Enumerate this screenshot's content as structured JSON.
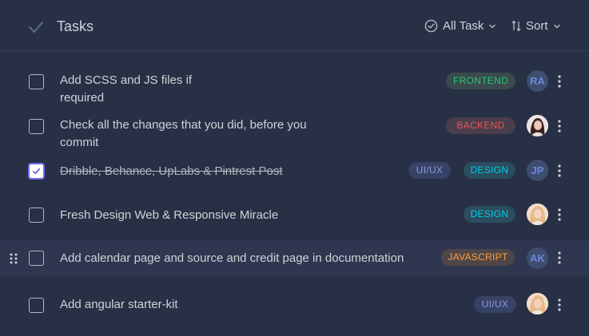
{
  "header": {
    "title": "Tasks",
    "filter_label": "All Task",
    "sort_label": "Sort"
  },
  "tasks": [
    {
      "title_lines": [
        "Add SCSS and JS files if",
        "required"
      ],
      "completed": false,
      "tags": [
        "FRONTEND"
      ],
      "assignee": {
        "initials": "RA",
        "avatar": "initials"
      }
    },
    {
      "title_lines": [
        "Check all the changes that you did, before you",
        "commit"
      ],
      "completed": false,
      "tags": [
        "BACKEND"
      ],
      "assignee": {
        "avatar": "photo"
      }
    },
    {
      "title_lines": [
        "Dribble, Behance, UpLabs & Pintrest Post"
      ],
      "completed": true,
      "tags": [
        "UI/UX",
        "DESIGN"
      ],
      "assignee": {
        "initials": "JP",
        "avatar": "initials"
      }
    },
    {
      "title_lines": [
        "Fresh Design Web & Responsive Miracle"
      ],
      "completed": false,
      "tags": [
        "DESIGN"
      ],
      "assignee": {
        "avatar": "photo"
      }
    },
    {
      "title_lines": [
        "Add calendar page and source and credit page in documentation"
      ],
      "completed": false,
      "hovered": true,
      "tags": [
        "JAVASCRIPT"
      ],
      "assignee": {
        "initials": "AK",
        "avatar": "initials"
      }
    },
    {
      "title_lines": [
        "Add angular starter-kit"
      ],
      "completed": false,
      "tags": [
        "UI/UX"
      ],
      "assignee": {
        "avatar": "photo"
      }
    }
  ],
  "colors": {
    "background": "#283046",
    "primary": "#7367f0",
    "frontend": "#28c76f",
    "backend": "#ea5455",
    "design": "#00cfe8",
    "javascript": "#ff9f43",
    "uiux": "#8a9bd8"
  }
}
